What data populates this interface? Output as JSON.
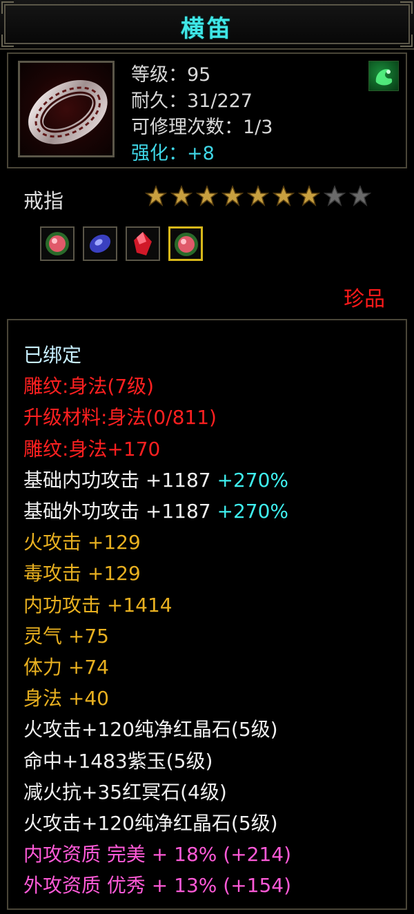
{
  "title": "横笛",
  "item": {
    "icon": "silver-ring-icon",
    "stats": {
      "level": "等级：95",
      "durability": "耐久：31/227",
      "repair_count": "可修理次数：1/3",
      "enhance": "强化：+8"
    },
    "badge_icon": "green-dragon-emblem-icon",
    "type": "戒指",
    "stars_filled": 7,
    "stars_total": 9,
    "gems": [
      {
        "icon": "red-green-gem-icon",
        "selected": false
      },
      {
        "icon": "purple-jade-gem-icon",
        "selected": false
      },
      {
        "icon": "red-crystal-gem-icon",
        "selected": false
      },
      {
        "icon": "red-green-gem-icon",
        "selected": true
      }
    ],
    "rarity": "珍品"
  },
  "attributes": [
    {
      "text": "已绑定",
      "color": "cyan"
    },
    {
      "text": "雕纹:身法(7级)",
      "color": "red"
    },
    {
      "text": "升级材料:身法(0/811)",
      "color": "red"
    },
    {
      "text": "雕纹:身法+170",
      "color": "red"
    },
    {
      "text": "基础内功攻击 +1187",
      "extra": " +270%",
      "color": "white"
    },
    {
      "text": "基础外功攻击 +1187",
      "extra": " +270%",
      "color": "white"
    },
    {
      "text": "火攻击 +129",
      "color": "yellow"
    },
    {
      "text": "毒攻击 +129",
      "color": "yellow"
    },
    {
      "text": "内功攻击 +1414",
      "color": "yellow"
    },
    {
      "text": "灵气 +75",
      "color": "yellow"
    },
    {
      "text": "体力 +74",
      "color": "yellow"
    },
    {
      "text": "身法 +40",
      "color": "yellow"
    },
    {
      "text": "火攻击+120纯净红晶石(5级)",
      "color": "white"
    },
    {
      "text": "命中+1483紫玉(5级)",
      "color": "white"
    },
    {
      "text": "减火抗+35红冥石(4级)",
      "color": "white"
    },
    {
      "text": "火攻击+120纯净红晶石(5级)",
      "color": "white"
    },
    {
      "text": "内攻资质 完美 + 18% (+214)",
      "color": "pink"
    },
    {
      "text": "外攻资质 优秀 + 13% (+154)",
      "color": "pink"
    }
  ],
  "colors": {
    "title": "#3fe6e6",
    "enhance": "#3fd6e6",
    "rarity": "#ff1a1a",
    "red": "#ff2020",
    "yellow": "#e8b020",
    "pink": "#ff5ad8",
    "teal": "#3ff0f0",
    "star_gold": "#c8a040",
    "star_grey": "#6a6a6a"
  }
}
